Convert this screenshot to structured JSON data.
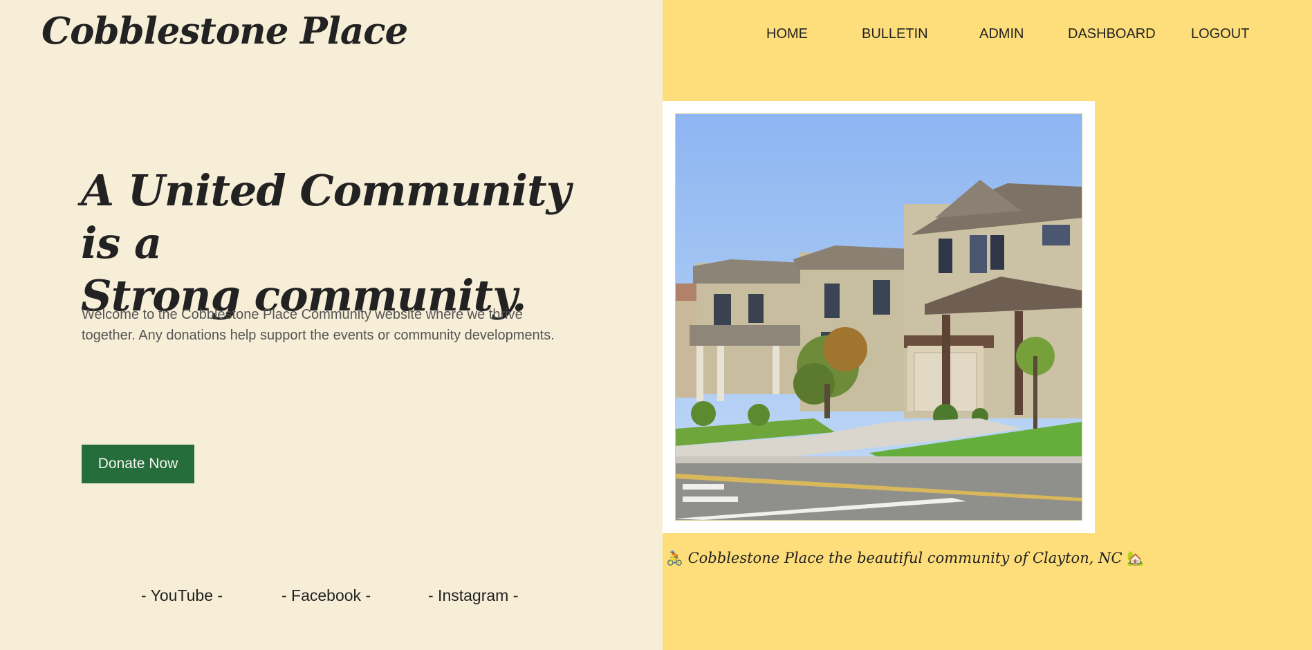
{
  "header": {
    "brand": "Cobblestone Place",
    "nav": [
      "HOME",
      "BULLETIN",
      "ADMIN",
      "DASHBOARD",
      "LOGOUT"
    ]
  },
  "hero": {
    "title_line1": "A United Community is a",
    "title_line2": "Strong community.",
    "description": "Welcome to the Cobblestone Place Community website where we thrive together. Any donations help support the events or community developments.",
    "donate_label": "Donate Now"
  },
  "socials": [
    "- YouTube -",
    "- Facebook -",
    "- Instagram -"
  ],
  "photo": {
    "alt_name": "suburban-houses-photo"
  },
  "caption": {
    "icon_left": "🚴",
    "text": "Cobblestone Place the beautiful community of Clayton, NC",
    "icon_right": "🏡"
  },
  "colors": {
    "left_bg": "#f7eed8",
    "right_bg": "#fede7a",
    "donate_bg": "#266d3c"
  }
}
